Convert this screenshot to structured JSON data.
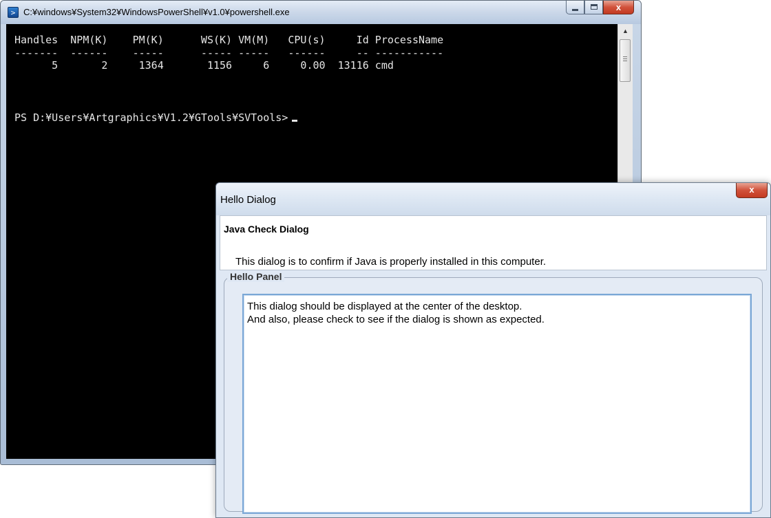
{
  "powershell": {
    "title": "C:¥windows¥System32¥WindowsPowerShell¥v1.0¥powershell.exe",
    "icon": "powershell-icon",
    "controls": {
      "minimize": "minimize",
      "maximize": "maximize",
      "close": "x"
    },
    "lines": {
      "header": "Handles  NPM(K)    PM(K)      WS(K) VM(M)   CPU(s)     Id ProcessName",
      "rule": "-------  ------    -----      ----- -----   ------     -- -----------",
      "row": "      5       2     1364       1156     6     0.00  13116 cmd",
      "prompt": "PS D:¥Users¥Artgraphics¥V1.2¥GTools¥SVTools>"
    }
  },
  "dialog": {
    "title": "Hello Dialog",
    "close_glyph": "x",
    "header_title": "Java Check Dialog",
    "header_description": "This dialog is to confirm if Java is properly installed in this computer.",
    "panel_title": "Hello Panel",
    "text_lines": [
      "This dialog should be displayed at the center of the desktop.",
      "And also, please check to see if the dialog is shown as expected."
    ]
  }
}
